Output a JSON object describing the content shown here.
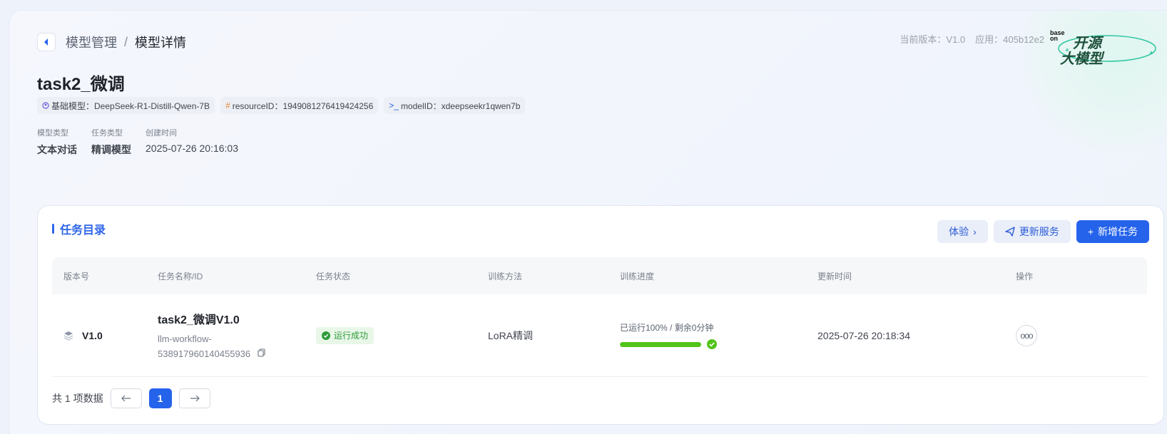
{
  "header": {
    "breadcrumb": [
      "模型管理",
      "模型详情"
    ],
    "breadcrumb_sep": "/",
    "title": "task2_微调",
    "version_label": "当前版本：V1.0",
    "app_label": "应用：405b12e2",
    "brand": {
      "small": "base on",
      "line1": "开源",
      "line2": "大模型"
    }
  },
  "tags": [
    {
      "icon": "robot-icon",
      "text": "基础模型：DeepSeek-R1-Distill-Qwen-7B"
    },
    {
      "icon": "hash-icon",
      "text": "resourceID：1949081276419424256"
    },
    {
      "icon": "terminal-icon",
      "text": "modelID：xdeepseekr1qwen7b"
    }
  ],
  "meta": [
    {
      "label": "模型类型",
      "value": "文本对话"
    },
    {
      "label": "任务类型",
      "value": "精调模型"
    },
    {
      "label": "创建时间",
      "value": "2025-07-26 20:16:03"
    }
  ],
  "panel": {
    "title": "任务目录",
    "buttons": {
      "try": "体验",
      "update": "更新服务",
      "add": "新增任务"
    }
  },
  "table": {
    "headers": [
      "版本号",
      "任务名称/ID",
      "任务状态",
      "训练方法",
      "训练进度",
      "更新时间",
      "操作"
    ],
    "rows": [
      {
        "version": "V1.0",
        "task_name": "task2_微调V1.0",
        "task_id_line1": "llm-workflow-",
        "task_id_line2": "538917960140455936",
        "status": "运行成功",
        "method": "LoRA精调",
        "progress_text": "已运行100% / 剩余0分钟",
        "progress": 1.0,
        "updated": "2025-07-26 20:18:34",
        "action": "ooo"
      }
    ]
  },
  "pagination": {
    "total_text": "共 1 项数据",
    "current_page": "1"
  },
  "colors": {
    "accent": "#2563eb",
    "success": "#52c41a",
    "status_bg": "#e8f7e8"
  }
}
